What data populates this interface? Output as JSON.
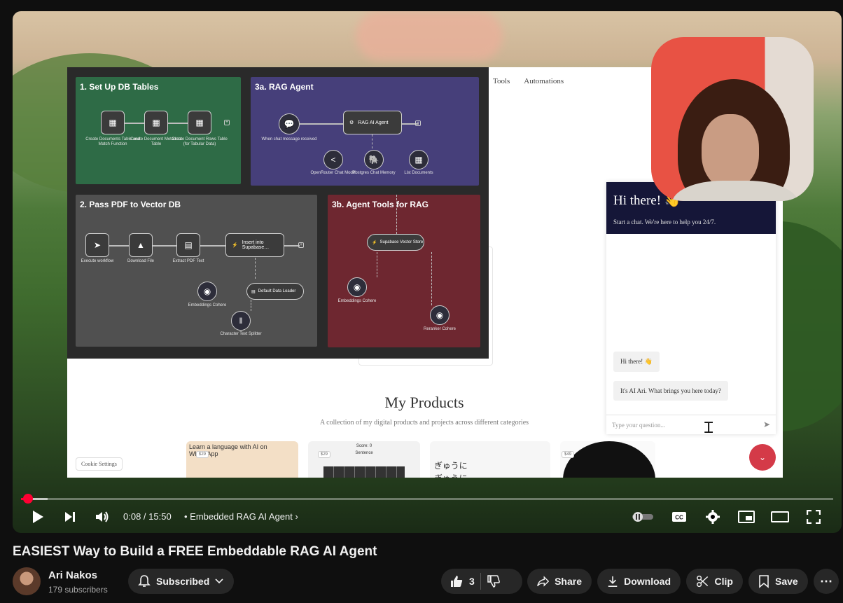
{
  "screen": {
    "panels": [
      {
        "title": "1. Set Up DB Tables"
      },
      {
        "title": "3a. RAG Agent"
      },
      {
        "title": "2. Pass PDF to Vector DB"
      },
      {
        "title": "3b. Agent Tools for RAG"
      }
    ],
    "nodes": {
      "p1": [
        "Create Documents Table and Match Function",
        "Create Document Metadata Table",
        "Create Document Rows Table (for Tabular Data)"
      ],
      "p2_trigger": "When chat message received",
      "p2_agent": "RAG AI Agent",
      "p2_subs": [
        "OpenRouter Chat Model",
        "Postgres Chat Memory",
        "List Documents"
      ],
      "p3": [
        "Execute workflow",
        "Download File",
        "Extract PDF Text"
      ],
      "p3_insert": "Insert into Supabase…",
      "p3_subs": [
        "Embeddings Cohere",
        "Default Data Loader",
        "Character Text Splitter"
      ],
      "p4_store": "Supabase Vector Store",
      "p4_subs": [
        "Embeddings Cohere",
        "Reranker Cohere"
      ]
    },
    "site_nav": [
      "Tools",
      "Automations"
    ],
    "site_heading": "My Products",
    "site_subheading": "A collection of my digital products and projects across different categories",
    "cookie_label": "Cookie Settings",
    "cards": {
      "c1_title": "Learn a language with AI on WhatsApp",
      "c1_badge": "$29",
      "c2_title": "Score: 0",
      "c2_sub": "Sentence",
      "c2_badge": "$29",
      "c3_jp1": "ぎゅうに",
      "c3_jp2": "ぎゅうに",
      "c4_badge": "$49"
    },
    "chat": {
      "greeting": "Hi there! 👋",
      "subtitle": "Start a chat. We're here to help you 24/7.",
      "messages": [
        "Hi there! 👋",
        "It's AI Ari. What brings you here today?"
      ],
      "input_placeholder": "Type your question...",
      "cursor_glyph": "Ɪ"
    }
  },
  "player": {
    "progress_fraction": 0.009,
    "time_current": "0:08",
    "time_total": "15:50",
    "time_display": "0:08 / 15:50",
    "chapter": "• Embedded RAG AI Agent",
    "chapter_chevron": "›"
  },
  "video": {
    "title": "EASIEST Way to Build a FREE Embeddable RAG AI Agent",
    "channel": "Ari Nakos",
    "subscribers": "179 subscribers",
    "subscribe_label": "Subscribed",
    "likes": "3",
    "share_label": "Share",
    "download_label": "Download",
    "clip_label": "Clip",
    "save_label": "Save",
    "more_label": "⋯"
  },
  "colors": {
    "accent_red": "#ff0033",
    "chat_header": "#151638",
    "chat_fab": "#d43a48"
  }
}
